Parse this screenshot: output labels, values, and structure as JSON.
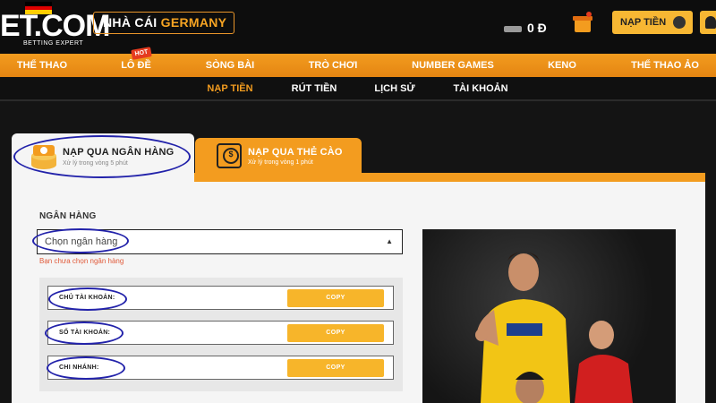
{
  "header": {
    "logo_text": "ET.COM",
    "logo_sub": "BETTING EXPERT",
    "brand_badge_prefix": "NHÀ CÁI ",
    "brand_badge_highlight": "GERMANY",
    "balance": "0 Đ",
    "deposit_button": "NẠP TIỀN"
  },
  "main_nav": {
    "items": [
      "THỂ THAO",
      "LÔ ĐỀ",
      "SÒNG BÀI",
      "TRÒ CHƠI",
      "NUMBER GAMES",
      "KENO",
      "THỂ THAO ẢO"
    ],
    "hot_badge": "HOT"
  },
  "sub_nav": {
    "items": [
      "NẠP TIỀN",
      "RÚT TIỀN",
      "LỊCH SỬ",
      "TÀI KHOẢN"
    ],
    "active": "NẠP TIỀN"
  },
  "tabs": [
    {
      "title": "NẠP QUA NGÂN HÀNG",
      "subtitle": "Xử lý trong vòng 5 phút",
      "active": true
    },
    {
      "title": "NẠP QUA THẺ CÀO",
      "subtitle": "Xử lý trong vòng 1 phút",
      "active": false
    }
  ],
  "form": {
    "bank_label": "NGÂN HÀNG",
    "bank_select_value": "Chọn ngân hàng",
    "bank_error": "Bạn chưa chọn ngân hàng",
    "rows": [
      {
        "label": "CHỦ TÀI KHOẢN:",
        "button": "COPY"
      },
      {
        "label": "SỐ TÀI KHOẢN:",
        "button": "COPY"
      },
      {
        "label": "CHI NHÁNH:",
        "button": "COPY"
      }
    ]
  },
  "colors": {
    "accent": "#f39c1f",
    "copy_button": "#f7b52a",
    "annotation": "#2222aa",
    "header_bg": "#0d0d0d"
  }
}
